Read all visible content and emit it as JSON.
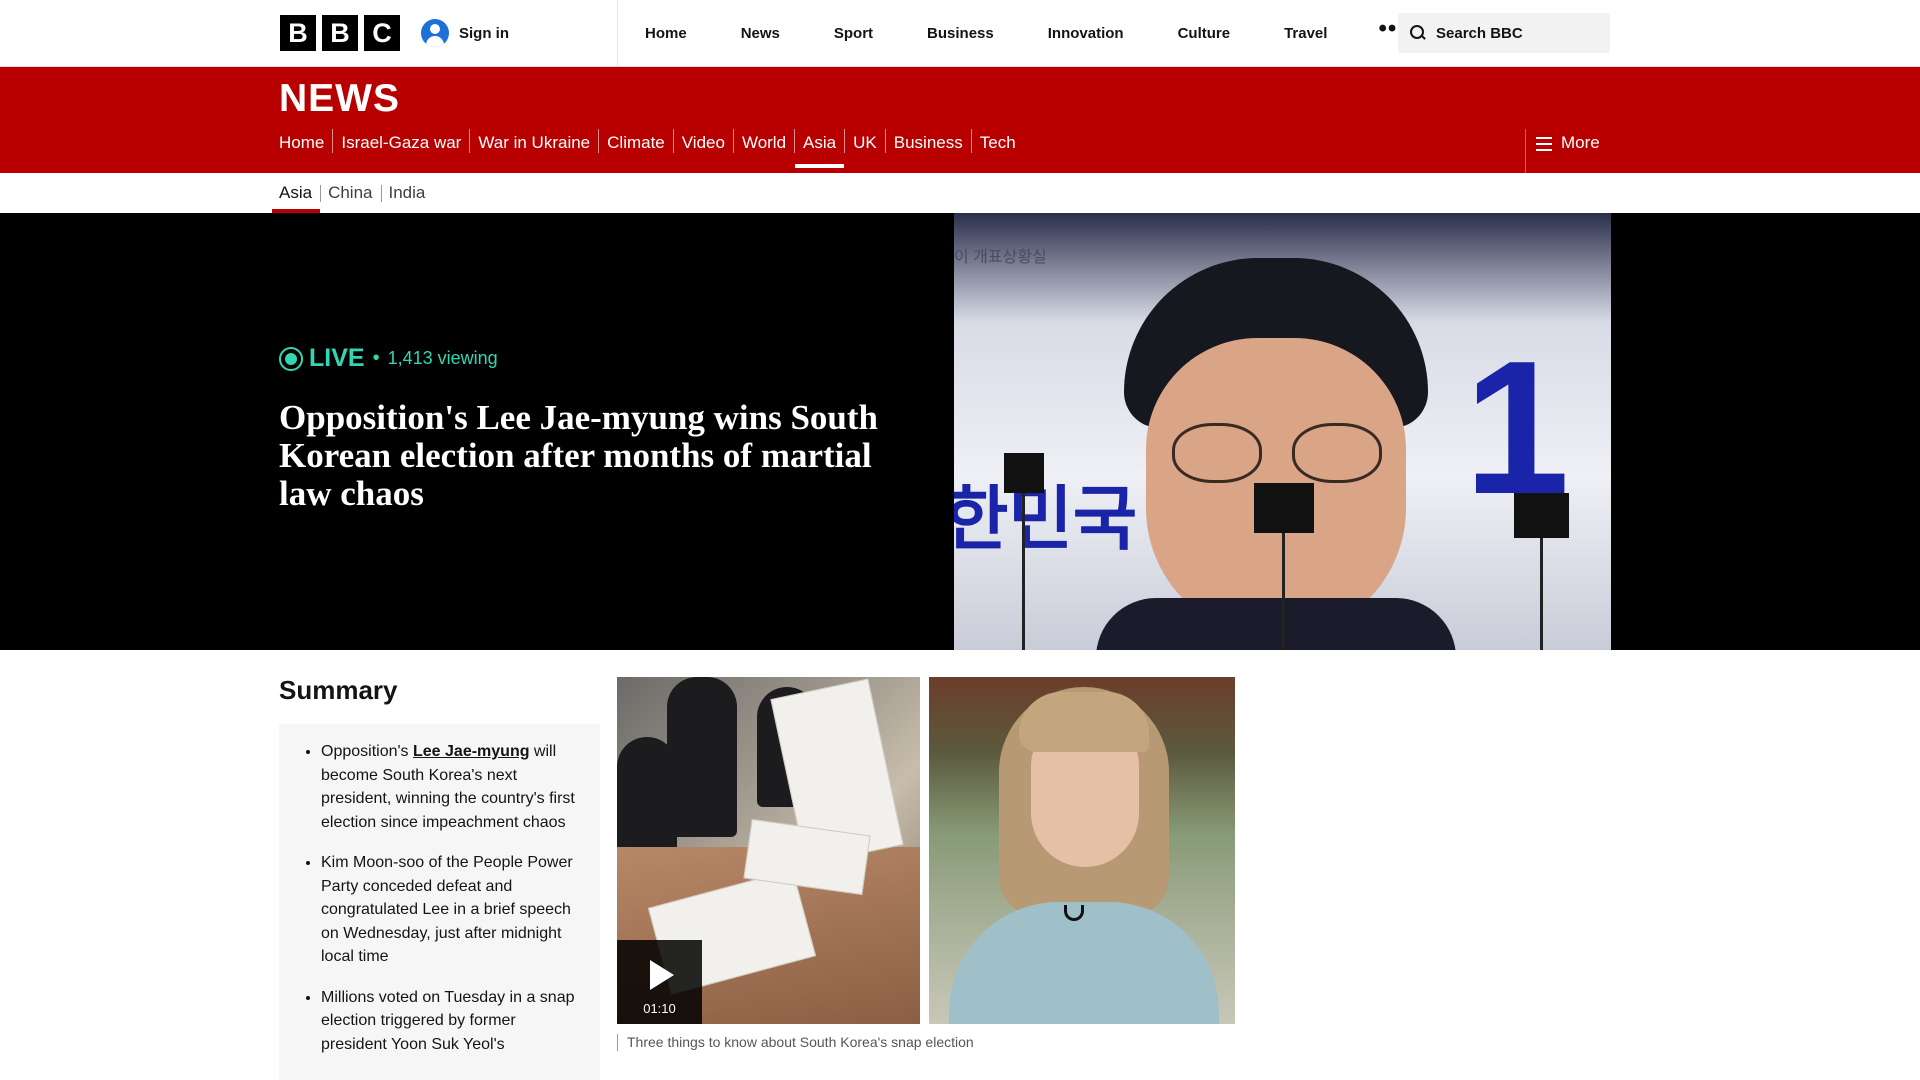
{
  "global_header": {
    "logo_letters": [
      "B",
      "B",
      "C"
    ],
    "sign_in_label": "Sign in",
    "nav": [
      "Home",
      "News",
      "Sport",
      "Business",
      "Innovation",
      "Culture",
      "Travel"
    ],
    "more_dots": "•••",
    "search_placeholder": "Search BBC"
  },
  "news_header": {
    "title": "NEWS",
    "nav": [
      {
        "label": "Home",
        "active": false
      },
      {
        "label": "Israel-Gaza war",
        "active": false
      },
      {
        "label": "War in Ukraine",
        "active": false
      },
      {
        "label": "Climate",
        "active": false
      },
      {
        "label": "Video",
        "active": false
      },
      {
        "label": "World",
        "active": false
      },
      {
        "label": "Asia",
        "active": true
      },
      {
        "label": "UK",
        "active": false
      },
      {
        "label": "Business",
        "active": false
      },
      {
        "label": "Tech",
        "active": false
      }
    ],
    "more_label": "More"
  },
  "sub_nav": [
    {
      "label": "Asia",
      "active": true
    },
    {
      "label": "China",
      "active": false
    },
    {
      "label": "India",
      "active": false
    }
  ],
  "hero": {
    "live_label": "LIVE",
    "separator": "•",
    "viewing": "1,413 viewing",
    "headline": "Opposition's Lee Jae-myung wins South Korean election after months of martial law chaos",
    "image_text_top": "이 개표상황실",
    "image_text_left": "한민국",
    "image_text_number": "1",
    "accent_color": "#33d6b3"
  },
  "summary": {
    "title": "Summary",
    "items": [
      {
        "before": "Opposition's ",
        "link": "Lee Jae-myung",
        "after": " will become South Korea's next president, winning the country's first election since impeachment chaos"
      },
      {
        "before": "Kim Moon-soo of the People Power Party conceded defeat and congratulated Lee in a brief speech on Wednesday, just after midnight local time",
        "link": "",
        "after": ""
      },
      {
        "before": "Millions voted on Tuesday in a snap election triggered by former president Yoon Suk Yeol's",
        "link": "",
        "after": ""
      }
    ]
  },
  "media": {
    "duration": "01:10",
    "caption": "Three things to know about South Korea's snap election"
  },
  "colors": {
    "brand_red": "#b80000",
    "hero_bg": "#000000"
  }
}
